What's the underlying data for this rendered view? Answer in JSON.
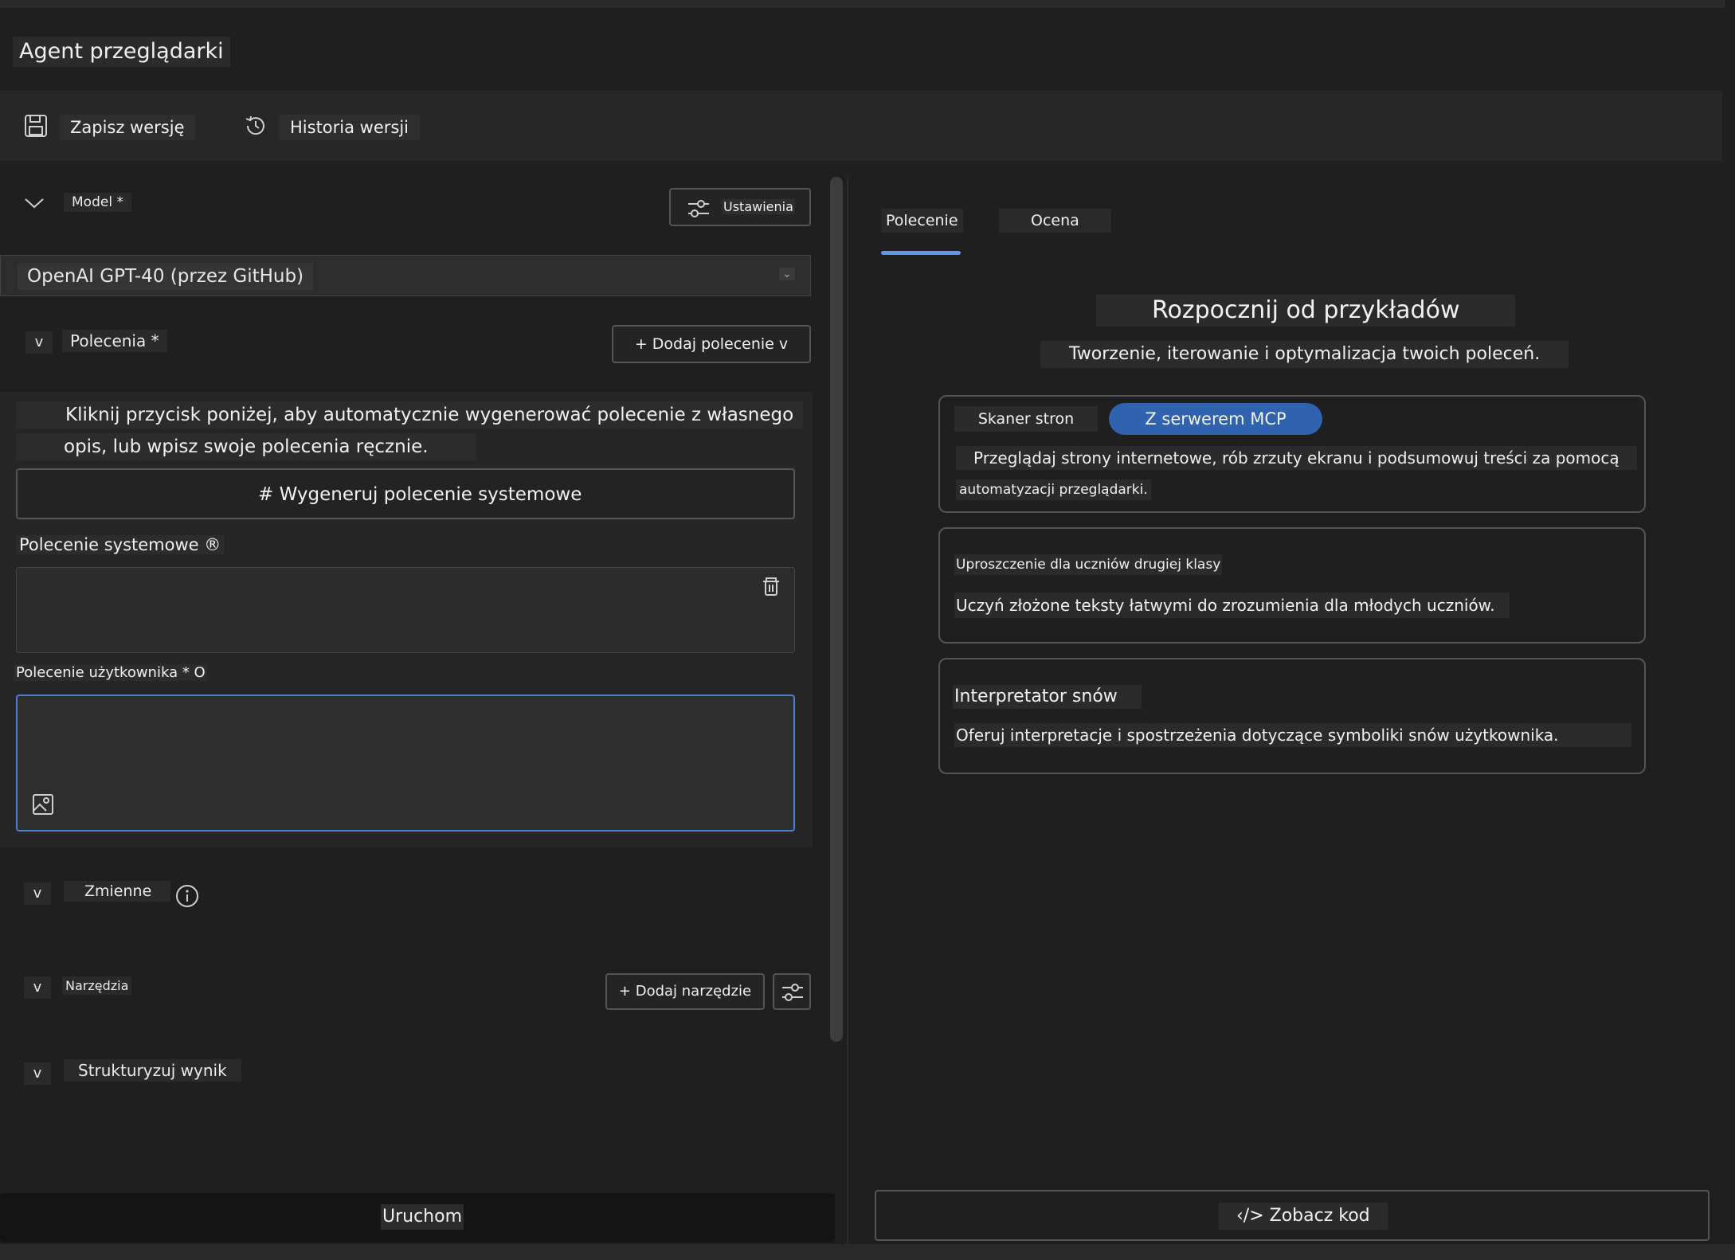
{
  "app": {
    "title": "Agent przeglądarki"
  },
  "toolbar": {
    "save_label": "Zapisz wersję",
    "history_label": "Historia wersji"
  },
  "model": {
    "label": "Model *",
    "settings_label": "Ustawienia",
    "selected": "OpenAI GPT-40 (przez GitHub)"
  },
  "prompts": {
    "label": "Polecenia *",
    "add_label": "+ Dodaj polecenie v",
    "info_line1": "Kliknij przycisk poniżej, aby automatycznie wygenerować polecenie z własnego",
    "info_line2": "opis, lub wpisz swoje polecenia ręcznie.",
    "generate_label": "# Wygeneruj polecenie systemowe",
    "system_label": "Polecenie systemowe ®",
    "user_label": "Polecenie użytkownika * O"
  },
  "variables": {
    "label": "Zmienne"
  },
  "tools": {
    "label": "Narzędzia",
    "add_label": "+ Dodaj narzędzie"
  },
  "structure": {
    "label": "Strukturyzuj wynik"
  },
  "collapse_letter": "v",
  "run_label": "Uruchom",
  "right": {
    "tabs": [
      {
        "label": "Polecenie",
        "active": true
      },
      {
        "label": "Ocena",
        "active": false
      }
    ],
    "heading": "Rozpocznij od przykładów",
    "subheading": "Tworzenie, iterowanie i optymalizacja twoich poleceń.",
    "cards": [
      {
        "chip1": "Skaner stron",
        "chip2": "Z serwerem MCP",
        "desc_line1": "Przeglądaj strony internetowe, rób zrzuty ekranu i podsumowuj treści za pomocą",
        "desc_line2": "automatyzacji przeglądarki."
      },
      {
        "title": "Uproszczenie dla uczniów drugiej klasy",
        "desc": "Uczyń złożone teksty łatwymi do zrozumienia dla młodych uczniów."
      },
      {
        "title": "Interpretator snów",
        "desc": "Oferuj interpretacje i spostrzeżenia dotyczące symboliki snów użytkownika."
      }
    ],
    "code_label": "‹/> Zobacz kod"
  },
  "colors": {
    "accent": "#5b9bea",
    "chip_active": "#2f63b0",
    "focus_border": "#4a7fd4"
  }
}
